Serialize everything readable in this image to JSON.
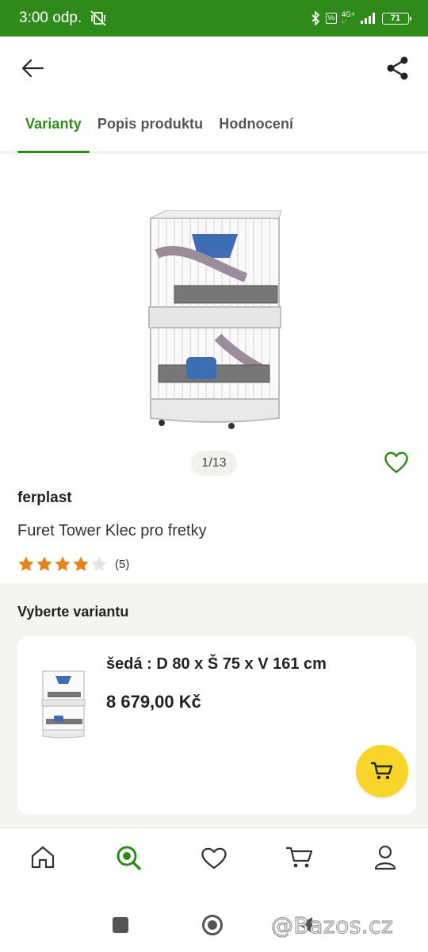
{
  "status_bar": {
    "time": "3:00 odp.",
    "network_top": "4G+",
    "network_bottom": "LTE",
    "battery": "71",
    "bg_color": "#2e8b19"
  },
  "app_bar": {
    "back_icon": "arrow-left-icon",
    "share_icon": "share-icon"
  },
  "tabs": [
    {
      "label": "Varianty",
      "active": true
    },
    {
      "label": "Popis produktu",
      "active": false
    },
    {
      "label": "Hodnocení",
      "active": false
    }
  ],
  "gallery": {
    "counter": "1/13",
    "favorite_icon": "heart-outline-icon"
  },
  "product": {
    "brand": "ferplast",
    "name": "Furet Tower Klec pro fretky",
    "rating_stars": 4,
    "rating_max": 5,
    "rating_count": "(5)"
  },
  "variants": {
    "title": "Vyberte variantu",
    "items": [
      {
        "name": "šedá : D 80 x Š 75 x V 161 cm",
        "price": "8 679,00 Kč",
        "cart_icon": "cart-icon"
      }
    ]
  },
  "bottom_nav": [
    {
      "name": "home",
      "icon": "home-icon",
      "active": false
    },
    {
      "name": "search",
      "icon": "search-icon",
      "active": true
    },
    {
      "name": "favorites",
      "icon": "heart-icon",
      "active": false
    },
    {
      "name": "cart",
      "icon": "cart-icon",
      "active": false
    },
    {
      "name": "profile",
      "icon": "user-icon",
      "active": false
    }
  ],
  "watermark": "@Bazos.cz",
  "colors": {
    "accent": "#2e8b19",
    "star": "#e8821c",
    "cart_button": "#f8d629"
  }
}
